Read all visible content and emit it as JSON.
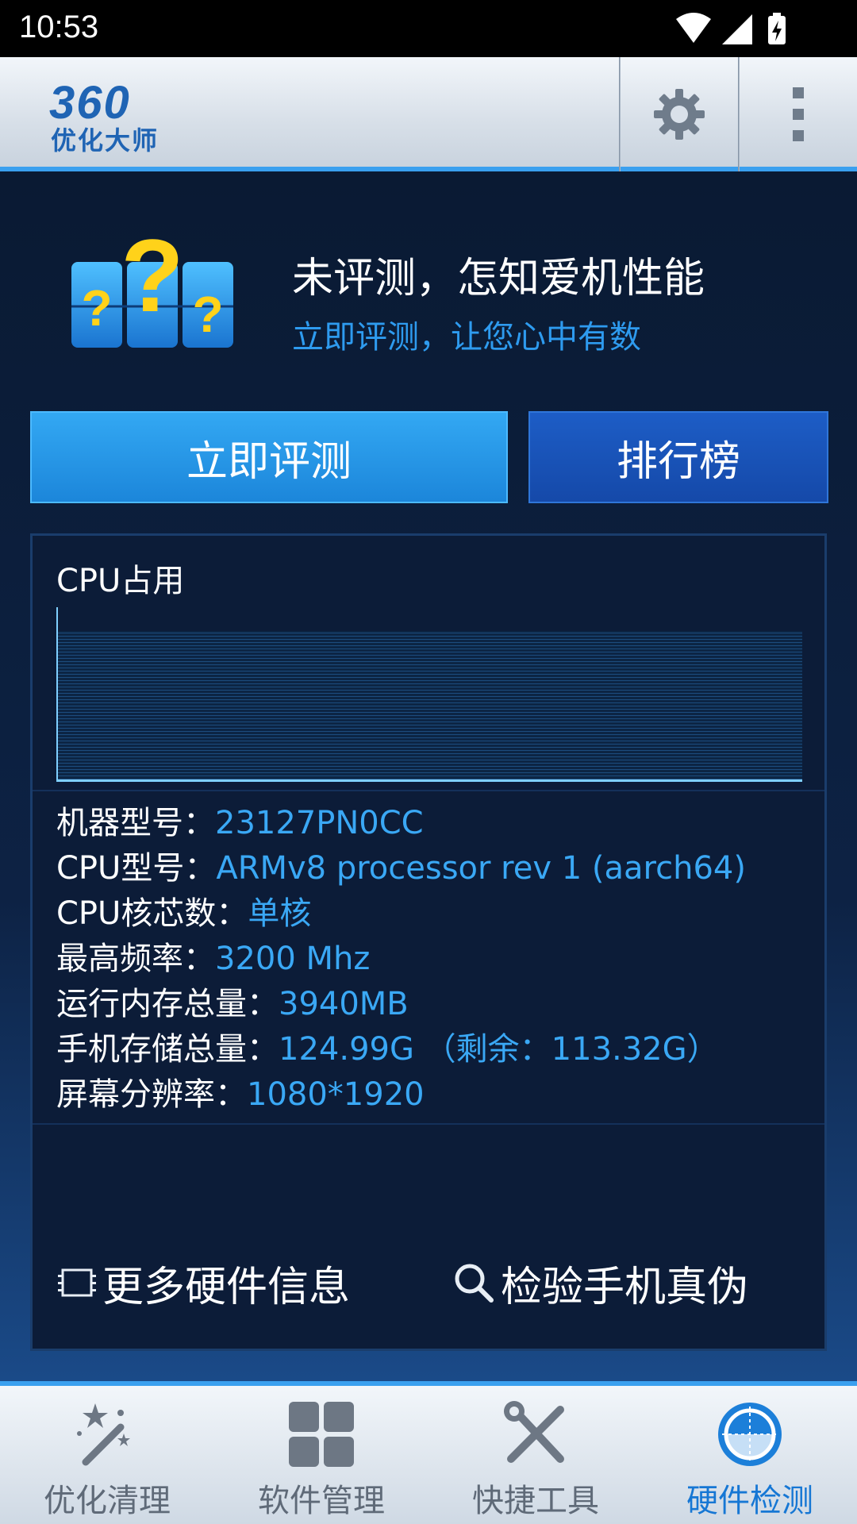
{
  "status_bar": {
    "time": "10:53"
  },
  "header": {
    "logo_number": "360",
    "logo_text": "优化大师",
    "settings_icon": "gear-icon",
    "menu_icon": "overflow-menu-icon"
  },
  "promo": {
    "icon": "question-blocks-icon",
    "title": "未评测，怎知爱机性能",
    "subtitle": "立即评测，让您心中有数"
  },
  "actions": {
    "evaluate_label": "立即评测",
    "ranking_label": "排行榜"
  },
  "cpu": {
    "label": "CPU占用"
  },
  "specs": [
    {
      "label": "机器型号：",
      "value": "23127PN0CC"
    },
    {
      "label": "CPU型号：",
      "value": "ARMv8 processor rev 1 (aarch64)"
    },
    {
      "label": "CPU核芯数：",
      "value": "单核"
    },
    {
      "label": "最高频率：",
      "value": "3200 Mhz"
    },
    {
      "label": "运行内存总量：",
      "value": "3940MB"
    },
    {
      "label": "手机存储总量：",
      "value": "124.99G （剩余：113.32G）"
    },
    {
      "label": "屏幕分辨率：",
      "value": "1080*1920"
    }
  ],
  "links": {
    "more_hardware": "更多硬件信息",
    "check_authenticity": "检验手机真伪"
  },
  "nav": [
    {
      "label": "优化清理",
      "icon": "magic-wand-icon",
      "active": false
    },
    {
      "label": "软件管理",
      "icon": "app-grid-icon",
      "active": false
    },
    {
      "label": "快捷工具",
      "icon": "tools-icon",
      "active": false
    },
    {
      "label": "硬件检测",
      "icon": "hardware-detect-icon",
      "active": true
    }
  ],
  "colors": {
    "accent": "#3aa0ef",
    "value_text": "#3aa8f5",
    "primary_button": "#1c86da",
    "secondary_button": "#1549a9"
  }
}
